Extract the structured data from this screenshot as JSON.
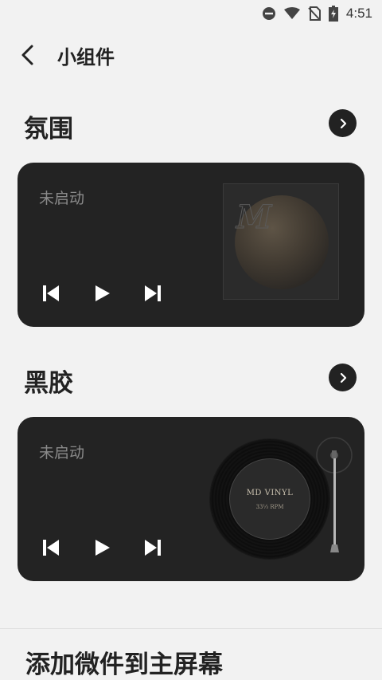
{
  "status_bar": {
    "time": "4:51",
    "icons": [
      "do-not-disturb-icon",
      "wifi-icon",
      "no-sim-icon",
      "battery-charging-icon"
    ]
  },
  "header": {
    "back_icon": "chevron-left-icon",
    "title": "小组件"
  },
  "sections": [
    {
      "title": "氛围",
      "arrow_icon": "chevron-right-icon",
      "card": {
        "status": "未启动",
        "art_logo": "M",
        "controls": [
          "skip-previous-icon",
          "play-icon",
          "skip-next-icon"
        ]
      }
    },
    {
      "title": "黑胶",
      "arrow_icon": "chevron-right-icon",
      "card": {
        "status": "未启动",
        "vinyl_title": "MD VINYL",
        "vinyl_rpm": "33⅓ RPM",
        "controls": [
          "skip-previous-icon",
          "play-icon",
          "skip-next-icon"
        ]
      }
    }
  ],
  "footer": {
    "add_widget_label": "添加微件到主屏幕"
  },
  "colors": {
    "background": "#f2f2f2",
    "card": "#232323",
    "text_primary": "#222222",
    "text_muted": "#8a8a8a"
  }
}
